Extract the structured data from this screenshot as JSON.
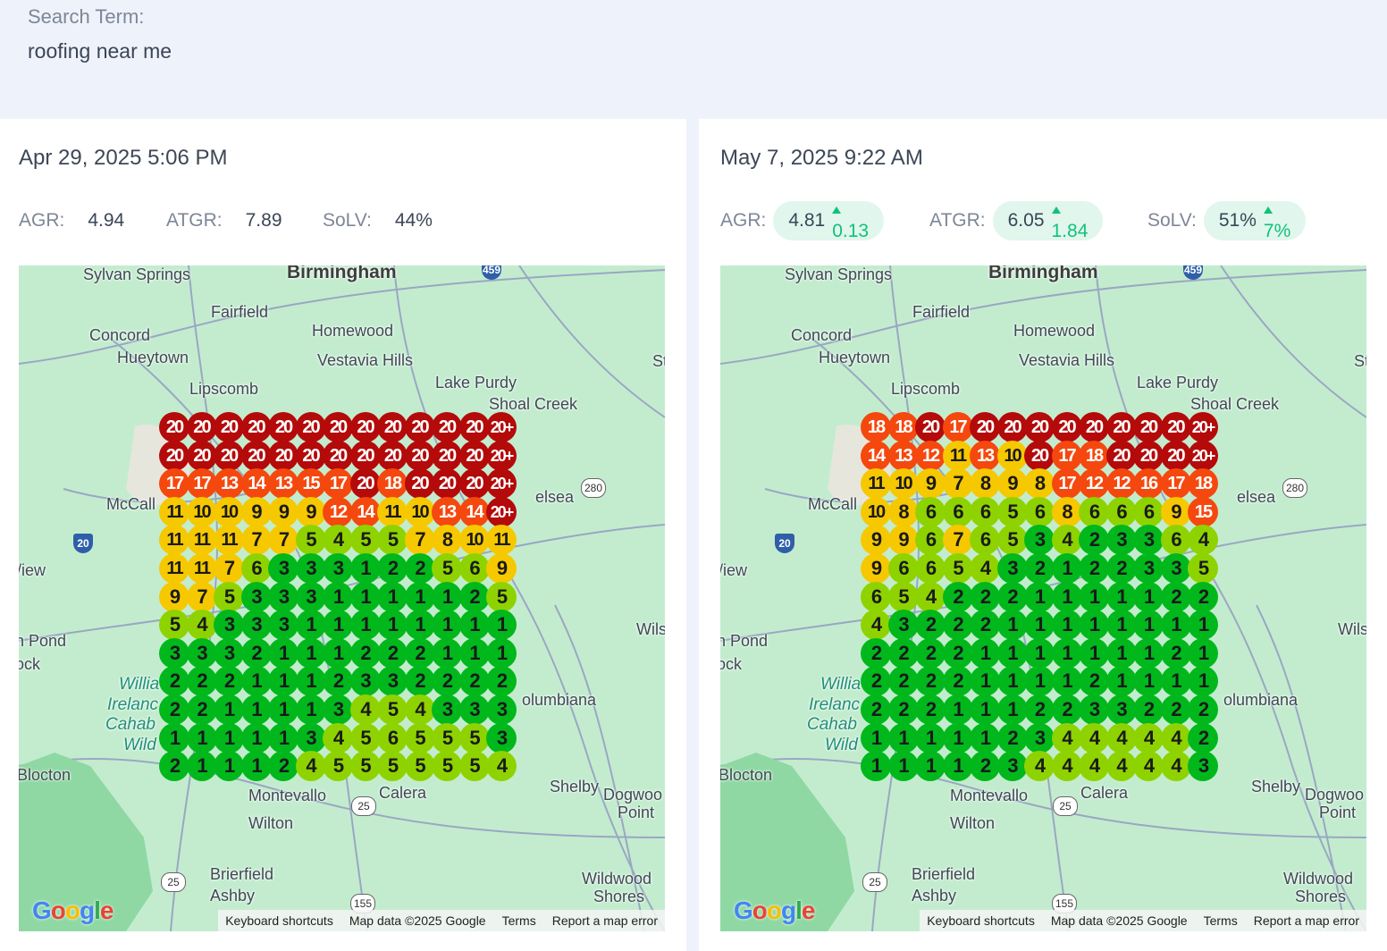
{
  "search": {
    "label": "Search Term:",
    "value": "roofing near me"
  },
  "colors": {
    "pill_bg": "#e1f6ed",
    "delta": "#10c27a",
    "rank_1": "#00b81c",
    "rank_low": "#8ed300",
    "rank_mid": "#f6c800",
    "rank_high": "#f5480e",
    "rank_top": "#b40a0a"
  },
  "map": {
    "labels": {
      "birmingham": "Birmingham",
      "sylvan": "Sylvan Springs",
      "fairfield": "Fairfield",
      "concord": "Concord",
      "hueytown": "Hueytown",
      "homewood": "Homewood",
      "vestavia": "Vestavia Hills",
      "lipscomb": "Lipscomb",
      "lake_purdy": "Lake Purdy",
      "shoal_creek": "Shoal Creek",
      "mccall": "McCall",
      "elsea": "elsea",
      "view": "/iew",
      "pond": "n Pond",
      "ock": "ock",
      "willi": "Willia",
      "ireland": "Irelanc",
      "cahaba": "Cahab",
      "wild": "Wild",
      "columbiana": "olumbiana",
      "wils": "Wils",
      "st": "St",
      "blocton": "Blocton",
      "montevallo": "Montevallo",
      "calera": "Calera",
      "shelby": "Shelby",
      "dogwood": "Dogwoo",
      "point": "Point",
      "wilton": "Wilton",
      "brierfield": "Brierfield",
      "ashby": "Ashby",
      "wildwood": "Wildwood",
      "shores": "Shores"
    },
    "shields": {
      "s459": "459",
      "s280": "280",
      "s20": "20",
      "s25a": "25",
      "s25b": "25",
      "s155": "155"
    },
    "footer": {
      "keyboard": "Keyboard shortcuts",
      "data": "Map data ©2025 Google",
      "terms": "Terms",
      "report": "Report a map error"
    },
    "google_letters": [
      "G",
      "o",
      "o",
      "g",
      "l",
      "e"
    ]
  },
  "panels": [
    {
      "date": "Apr 29, 2025 5:06 PM",
      "agr": {
        "label": "AGR:",
        "value": "4.94",
        "delta": null
      },
      "atgr": {
        "label": "ATGR:",
        "value": "7.89",
        "delta": null
      },
      "solv": {
        "label": "SoLV:",
        "value": "44%",
        "delta": null
      },
      "grid": [
        [
          "20",
          "20",
          "20",
          "20",
          "20",
          "20",
          "20",
          "20",
          "20",
          "20",
          "20",
          "20",
          "20+"
        ],
        [
          "20",
          "20",
          "20",
          "20",
          "20",
          "20",
          "20",
          "20",
          "20",
          "20",
          "20",
          "20",
          "20+"
        ],
        [
          "17",
          "17",
          "13",
          "14",
          "13",
          "15",
          "17",
          "20",
          "18",
          "20",
          "20",
          "20",
          "20+"
        ],
        [
          "11",
          "10",
          "10",
          "9",
          "9",
          "9",
          "12",
          "14",
          "11",
          "10",
          "13",
          "14",
          "20+"
        ],
        [
          "11",
          "11",
          "11",
          "7",
          "7",
          "5",
          "4",
          "5",
          "5",
          "7",
          "8",
          "10",
          "11"
        ],
        [
          "11",
          "11",
          "7",
          "6",
          "3",
          "3",
          "3",
          "1",
          "2",
          "2",
          "5",
          "6",
          "9"
        ],
        [
          "9",
          "7",
          "5",
          "3",
          "3",
          "3",
          "1",
          "1",
          "1",
          "1",
          "1",
          "2",
          "5"
        ],
        [
          "5",
          "4",
          "3",
          "3",
          "3",
          "1",
          "1",
          "1",
          "1",
          "1",
          "1",
          "1",
          "1"
        ],
        [
          "3",
          "3",
          "3",
          "2",
          "1",
          "1",
          "1",
          "2",
          "2",
          "2",
          "1",
          "1",
          "1"
        ],
        [
          "2",
          "2",
          "2",
          "1",
          "1",
          "1",
          "2",
          "3",
          "3",
          "2",
          "2",
          "2",
          "2"
        ],
        [
          "2",
          "2",
          "1",
          "1",
          "1",
          "1",
          "3",
          "4",
          "5",
          "4",
          "3",
          "3",
          "3"
        ],
        [
          "1",
          "1",
          "1",
          "1",
          "1",
          "3",
          "4",
          "5",
          "6",
          "5",
          "5",
          "5",
          "3"
        ],
        [
          "2",
          "1",
          "1",
          "1",
          "2",
          "4",
          "5",
          "5",
          "5",
          "5",
          "5",
          "5",
          "4"
        ]
      ]
    },
    {
      "date": "May 7, 2025 9:22 AM",
      "agr": {
        "label": "AGR:",
        "value": "4.81",
        "delta": "0.13"
      },
      "atgr": {
        "label": "ATGR:",
        "value": "6.05",
        "delta": "1.84"
      },
      "solv": {
        "label": "SoLV:",
        "value": "51%",
        "delta": "7%"
      },
      "grid": [
        [
          "18",
          "18",
          "20",
          "17",
          "20",
          "20",
          "20",
          "20",
          "20",
          "20",
          "20",
          "20",
          "20+"
        ],
        [
          "14",
          "13",
          "12",
          "11",
          "13",
          "10",
          "20",
          "17",
          "18",
          "20",
          "20",
          "20",
          "20+"
        ],
        [
          "11",
          "10",
          "9",
          "7",
          "8",
          "9",
          "8",
          "17",
          "12",
          "12",
          "16",
          "17",
          "18"
        ],
        [
          "10",
          "8",
          "6",
          "6",
          "6",
          "5",
          "6",
          "8",
          "6",
          "6",
          "6",
          "9",
          "15"
        ],
        [
          "9",
          "9",
          "6",
          "7",
          "6",
          "5",
          "3",
          "4",
          "2",
          "3",
          "3",
          "6",
          "4"
        ],
        [
          "9",
          "6",
          "6",
          "5",
          "4",
          "3",
          "2",
          "1",
          "2",
          "2",
          "3",
          "3",
          "5"
        ],
        [
          "6",
          "5",
          "4",
          "2",
          "2",
          "2",
          "1",
          "1",
          "1",
          "1",
          "1",
          "2",
          "2"
        ],
        [
          "4",
          "3",
          "2",
          "2",
          "2",
          "1",
          "1",
          "1",
          "1",
          "1",
          "1",
          "1",
          "1"
        ],
        [
          "2",
          "2",
          "2",
          "2",
          "1",
          "1",
          "1",
          "1",
          "1",
          "1",
          "1",
          "2",
          "1"
        ],
        [
          "2",
          "2",
          "2",
          "2",
          "1",
          "1",
          "1",
          "1",
          "2",
          "1",
          "1",
          "1",
          "1"
        ],
        [
          "2",
          "2",
          "2",
          "1",
          "1",
          "1",
          "2",
          "2",
          "3",
          "3",
          "2",
          "2",
          "2"
        ],
        [
          "1",
          "1",
          "1",
          "1",
          "1",
          "2",
          "3",
          "4",
          "4",
          "4",
          "4",
          "4",
          "2"
        ],
        [
          "1",
          "1",
          "1",
          "1",
          "2",
          "3",
          "4",
          "4",
          "4",
          "4",
          "4",
          "4",
          "3"
        ]
      ]
    }
  ]
}
